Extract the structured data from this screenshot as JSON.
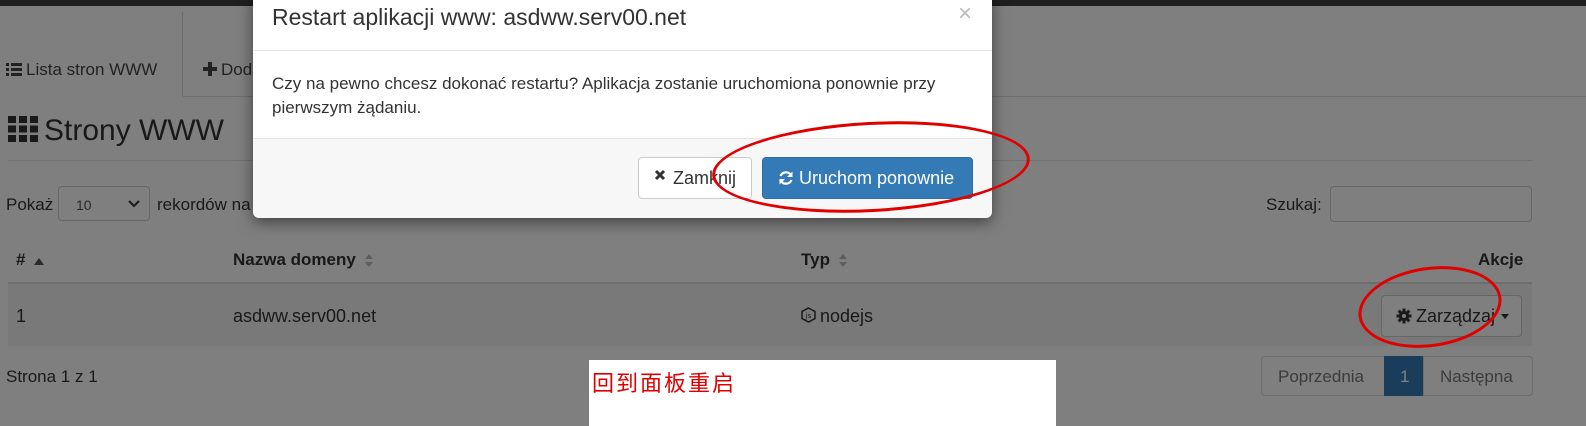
{
  "tabs": [
    {
      "label": "Lista stron WWW",
      "icon": "list-icon"
    },
    {
      "label": "Dodaj",
      "icon": "plus-icon"
    }
  ],
  "page_title": "Strony WWW",
  "length_menu": {
    "prefix": "Pokaż",
    "value": "10",
    "suffix": "rekordów na stronę"
  },
  "search": {
    "label": "Szukaj:",
    "value": ""
  },
  "table": {
    "headers": [
      "#",
      "Nazwa domeny",
      "Typ",
      "Akcje"
    ],
    "rows": [
      {
        "id": "1",
        "domain": "asdww.serv00.net",
        "type": "nodejs",
        "action": "Zarządzaj"
      }
    ]
  },
  "info": "Strona 1 z 1",
  "pagination": {
    "prev": "Poprzednia",
    "current": "1",
    "next": "Następna"
  },
  "modal": {
    "title": "Restart aplikacji www: asdww.serv00.net",
    "body": "Czy na pewno chcesz dokonać restartu? Aplikacja zostanie uruchomiona ponownie przy pierwszym żądaniu.",
    "close_button": "Zamknij",
    "restart_button": "Uruchom ponownie",
    "close_x": "×"
  },
  "annotation": {
    "text": "回到面板重启",
    "color": "#e00000"
  },
  "colors": {
    "primary": "#337ab7",
    "annotation_red": "#e00000",
    "topbar": "#1f1f1f"
  }
}
